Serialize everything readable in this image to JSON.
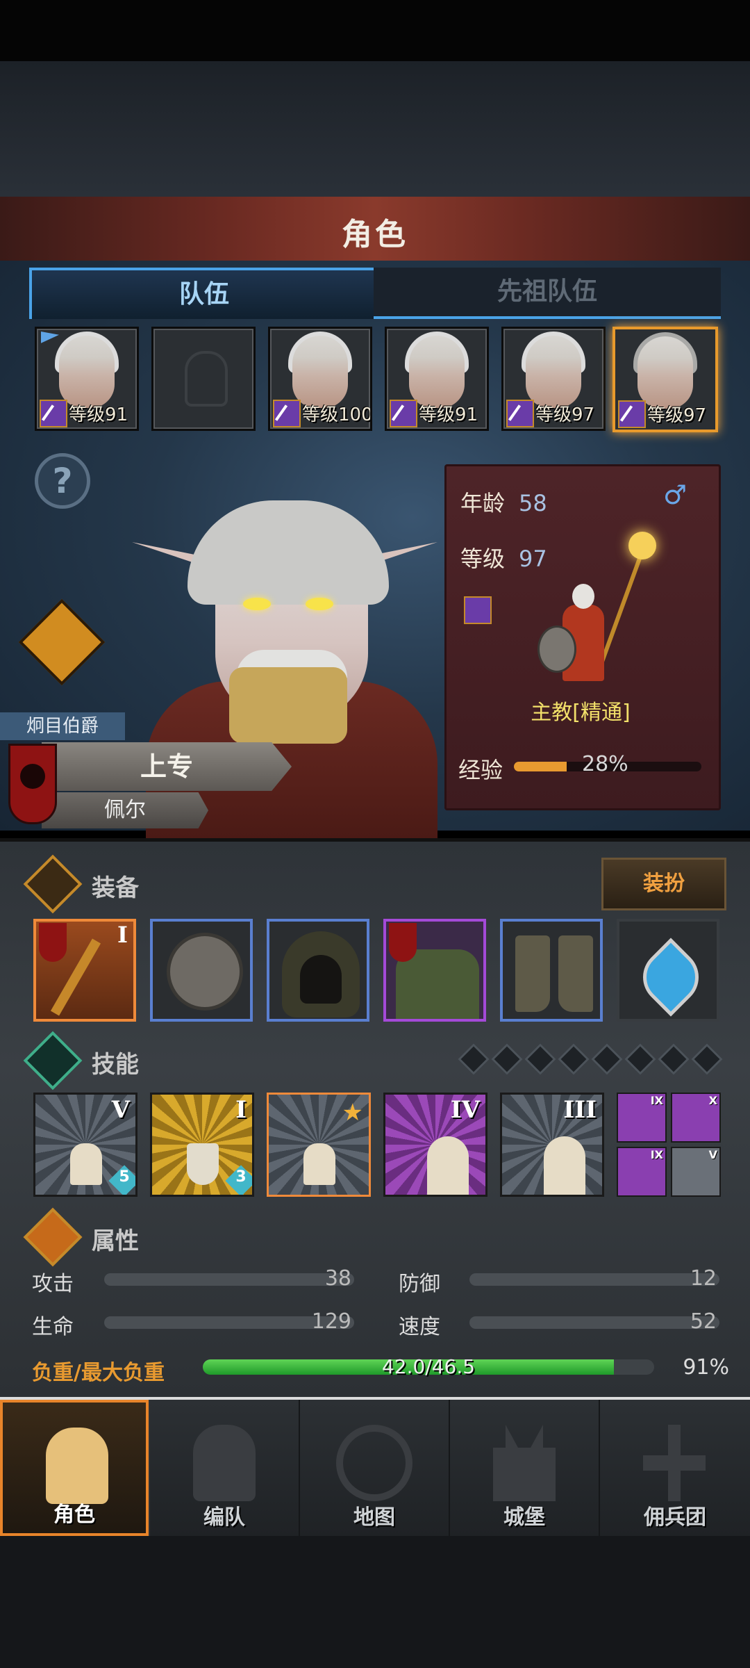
{
  "header": {
    "title": "角色"
  },
  "tabs": [
    {
      "label": "队伍",
      "active": true
    },
    {
      "label": "先祖队伍",
      "active": false
    }
  ],
  "party": [
    {
      "level": "等级91",
      "flag": true
    },
    {
      "level": "",
      "empty": true
    },
    {
      "level": "等级100"
    },
    {
      "level": "等级91"
    },
    {
      "level": "等级97"
    },
    {
      "level": "等级97",
      "selected": true
    }
  ],
  "character": {
    "title_badge": "炯目伯爵",
    "rank": "上专",
    "name": "佩尔",
    "age_label": "年龄",
    "age": "58",
    "gender_icon": "♂",
    "level_label": "等级",
    "level": "97",
    "class_name": "主教[精通]",
    "exp_label": "经验",
    "exp_percent": "28%",
    "exp_fraction": 0.28
  },
  "equipment": {
    "title": "装备",
    "dressup_label": "装扮",
    "items": [
      {
        "name": "staff",
        "rarity": "orange",
        "roman": "I"
      },
      {
        "name": "round-shield",
        "rarity": "blue"
      },
      {
        "name": "hood",
        "rarity": "blue"
      },
      {
        "name": "robe",
        "rarity": "purple"
      },
      {
        "name": "boots",
        "rarity": "blue"
      },
      {
        "name": "heart-amulet",
        "rarity": "none"
      }
    ]
  },
  "skills": {
    "title": "技能",
    "gem_slots": 8,
    "items": [
      {
        "roman": "V",
        "badge": "5",
        "color": "gray"
      },
      {
        "roman": "I",
        "badge": "3",
        "color": "gold"
      },
      {
        "roman": "",
        "star": true,
        "color": "orange"
      },
      {
        "roman": "IV",
        "color": "purple"
      },
      {
        "roman": "III",
        "color": "gray"
      }
    ],
    "minis": [
      {
        "roman": "IX",
        "color": "purple"
      },
      {
        "roman": "X",
        "color": "purple"
      },
      {
        "roman": "IX",
        "color": "purple"
      },
      {
        "roman": "V",
        "color": "gray"
      }
    ]
  },
  "attributes": {
    "title": "属性",
    "attack_label": "攻击",
    "attack": "38",
    "defense_label": "防御",
    "defense": "12",
    "hp_label": "生命",
    "hp": "129",
    "speed_label": "速度",
    "speed": "52",
    "load_label": "负重/最大负重",
    "load_value": "42.0/46.5",
    "load_percent": "91%",
    "load_fraction": 0.91
  },
  "nav": [
    {
      "label": "角色",
      "active": true
    },
    {
      "label": "编队"
    },
    {
      "label": "地图"
    },
    {
      "label": "城堡"
    },
    {
      "label": "佣兵团"
    }
  ],
  "colors": {
    "accent": "#e8842a",
    "tab_blue": "#4aa3e8",
    "exp": "#e89a30",
    "load": "#3fbf3f"
  }
}
